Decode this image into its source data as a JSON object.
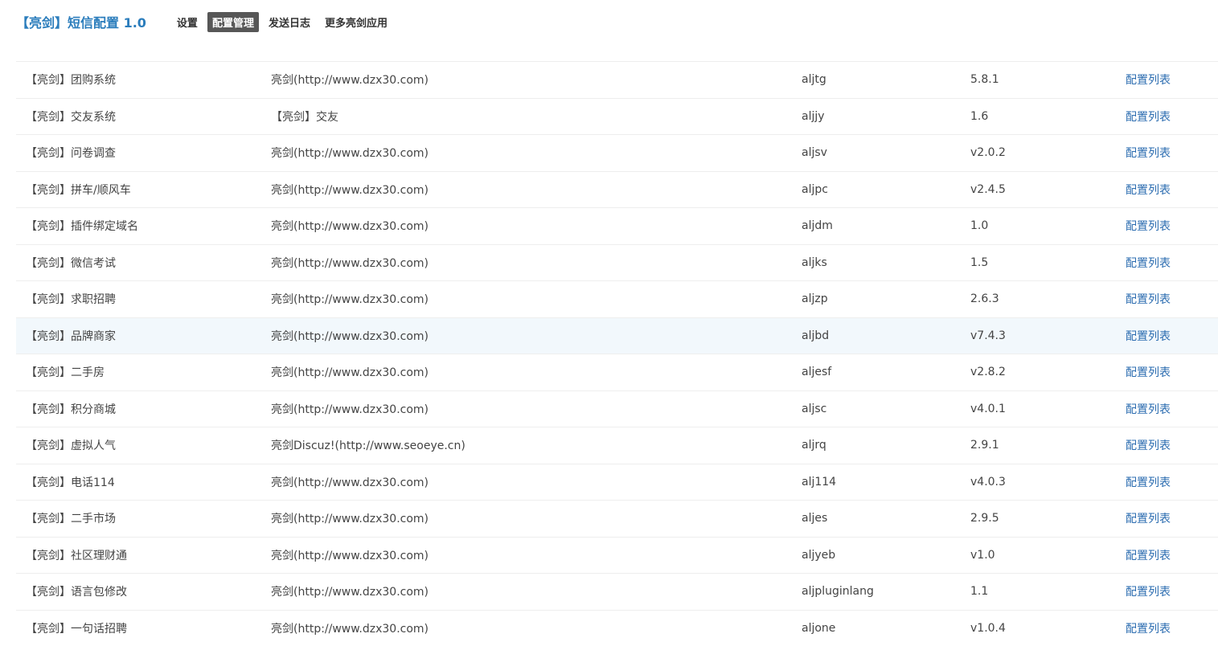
{
  "header": {
    "app_title": "【亮剑】短信配置 1.0",
    "tabs": [
      {
        "label": "设置",
        "active": false
      },
      {
        "label": "配置管理",
        "active": true
      },
      {
        "label": "发送日志",
        "active": false
      },
      {
        "label": "更多亮剑应用",
        "active": false
      }
    ]
  },
  "table": {
    "rows": [
      {
        "name": "【亮剑】团购系统",
        "author": "亮剑(http://www.dzx30.com)",
        "id": "aljtg",
        "version": "5.8.1",
        "action": "配置列表"
      },
      {
        "name": "【亮剑】交友系统",
        "author": "【亮剑】交友",
        "id": "aljjy",
        "version": "1.6",
        "action": "配置列表"
      },
      {
        "name": "【亮剑】问卷调查",
        "author": "亮剑(http://www.dzx30.com)",
        "id": "aljsv",
        "version": "v2.0.2",
        "action": "配置列表"
      },
      {
        "name": "【亮剑】拼车/顺风车",
        "author": "亮剑(http://www.dzx30.com)",
        "id": "aljpc",
        "version": "v2.4.5",
        "action": "配置列表"
      },
      {
        "name": "【亮剑】插件绑定域名",
        "author": "亮剑(http://www.dzx30.com)",
        "id": "aljdm",
        "version": "1.0",
        "action": "配置列表"
      },
      {
        "name": "【亮剑】微信考试",
        "author": "亮剑(http://www.dzx30.com)",
        "id": "aljks",
        "version": "1.5",
        "action": "配置列表"
      },
      {
        "name": "【亮剑】求职招聘",
        "author": "亮剑(http://www.dzx30.com)",
        "id": "aljzp",
        "version": "2.6.3",
        "action": "配置列表"
      },
      {
        "name": "【亮剑】品牌商家",
        "author": "亮剑(http://www.dzx30.com)",
        "id": "aljbd",
        "version": "v7.4.3",
        "action": "配置列表",
        "highlight": true
      },
      {
        "name": "【亮剑】二手房",
        "author": "亮剑(http://www.dzx30.com)",
        "id": "aljesf",
        "version": "v2.8.2",
        "action": "配置列表"
      },
      {
        "name": "【亮剑】积分商城",
        "author": "亮剑(http://www.dzx30.com)",
        "id": "aljsc",
        "version": "v4.0.1",
        "action": "配置列表"
      },
      {
        "name": "【亮剑】虚拟人气",
        "author": "亮剑Discuz!(http://www.seoeye.cn)",
        "id": "aljrq",
        "version": "2.9.1",
        "action": "配置列表"
      },
      {
        "name": "【亮剑】电话114",
        "author": "亮剑(http://www.dzx30.com)",
        "id": "alj114",
        "version": "v4.0.3",
        "action": "配置列表"
      },
      {
        "name": "【亮剑】二手市场",
        "author": "亮剑(http://www.dzx30.com)",
        "id": "aljes",
        "version": "2.9.5",
        "action": "配置列表"
      },
      {
        "name": "【亮剑】社区理财通",
        "author": "亮剑(http://www.dzx30.com)",
        "id": "aljyeb",
        "version": "v1.0",
        "action": "配置列表"
      },
      {
        "name": "【亮剑】语言包修改",
        "author": "亮剑(http://www.dzx30.com)",
        "id": "aljpluginlang",
        "version": "1.1",
        "action": "配置列表"
      },
      {
        "name": "【亮剑】一句话招聘",
        "author": "亮剑(http://www.dzx30.com)",
        "id": "aljone",
        "version": "v1.0.4",
        "action": "配置列表"
      }
    ]
  }
}
